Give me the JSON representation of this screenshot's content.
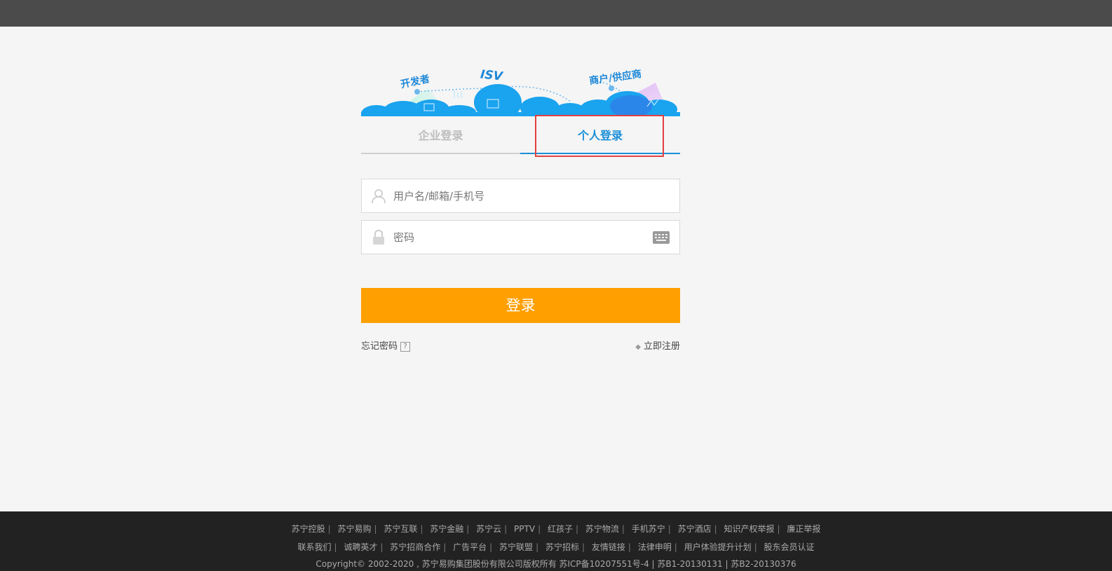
{
  "banner": {
    "developer_label": "开发者",
    "isv_label": "ISV",
    "merchant_label": "商户/供应商"
  },
  "tabs": {
    "company": "企业登录",
    "personal": "个人登录",
    "active": "personal"
  },
  "form": {
    "username_placeholder": "用户名/邮箱/手机号",
    "username_value": "",
    "password_placeholder": "密码",
    "password_value": "",
    "login_label": "登录",
    "forgot_label": "忘记密码",
    "help_glyph": "?",
    "register_label": "立即注册"
  },
  "footer": {
    "row1": [
      "苏宁控股",
      "苏宁易购",
      "苏宁互联",
      "苏宁金融",
      "苏宁云",
      "PPTV",
      "红孩子",
      "苏宁物流",
      "手机苏宁",
      "苏宁酒店",
      "知识产权举报",
      "廉正举报"
    ],
    "row2": [
      "联系我们",
      "诚聘英才",
      "苏宁招商合作",
      "广告平台",
      "苏宁联盟",
      "苏宁招标",
      "友情链接",
      "法律申明",
      "用户体验提升计划",
      "股东会员认证"
    ],
    "copyright": "Copyright© 2002-2020 , 苏宁易购集团股份有限公司版权所有 苏ICP备10207551号-4 | 苏B1-20130131 | 苏B2-20130376"
  },
  "colors": {
    "topbar": "#4b4b4b",
    "accent_blue": "#1a8fd8",
    "login_orange": "#ff9f00",
    "highlight_red": "#e34040",
    "footer_bg": "#222222"
  },
  "icons": {
    "username": "user-icon",
    "password": "lock-icon",
    "keyboard": "keyboard-icon",
    "help": "help-icon",
    "register": "arrow-left-icon"
  }
}
